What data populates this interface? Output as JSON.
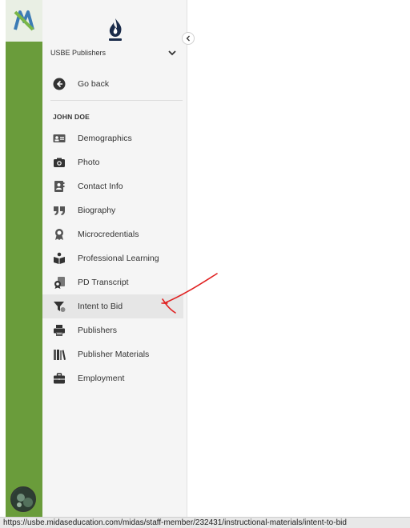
{
  "app": {
    "logo_icon": "midas-logo-icon"
  },
  "sidebar": {
    "org_logo_icon": "usbe-flame-logo-icon",
    "org_name": "USBE Publishers",
    "back_label": "Go back",
    "section_title": "JOHN DOE",
    "items": [
      {
        "label": "Demographics",
        "icon": "id-card-icon"
      },
      {
        "label": "Photo",
        "icon": "camera-icon"
      },
      {
        "label": "Contact Info",
        "icon": "contact-card-icon"
      },
      {
        "label": "Biography",
        "icon": "quote-icon"
      },
      {
        "label": "Microcredentials",
        "icon": "award-icon"
      },
      {
        "label": "Professional Learning",
        "icon": "reading-icon"
      },
      {
        "label": "PD Transcript",
        "icon": "transcript-icon"
      },
      {
        "label": "Intent to Bid",
        "icon": "filter-icon",
        "active": true
      },
      {
        "label": "Publishers",
        "icon": "printer-icon"
      },
      {
        "label": "Publisher Materials",
        "icon": "books-icon"
      },
      {
        "label": "Employment",
        "icon": "briefcase-icon"
      }
    ]
  },
  "status_bar": {
    "url": "https://usbe.midaseducation.com/midas/staff-member/232431/instructional-materials/intent-to-bid"
  },
  "colors": {
    "rail": "#6a9c3b",
    "annotation": "#e02020"
  }
}
